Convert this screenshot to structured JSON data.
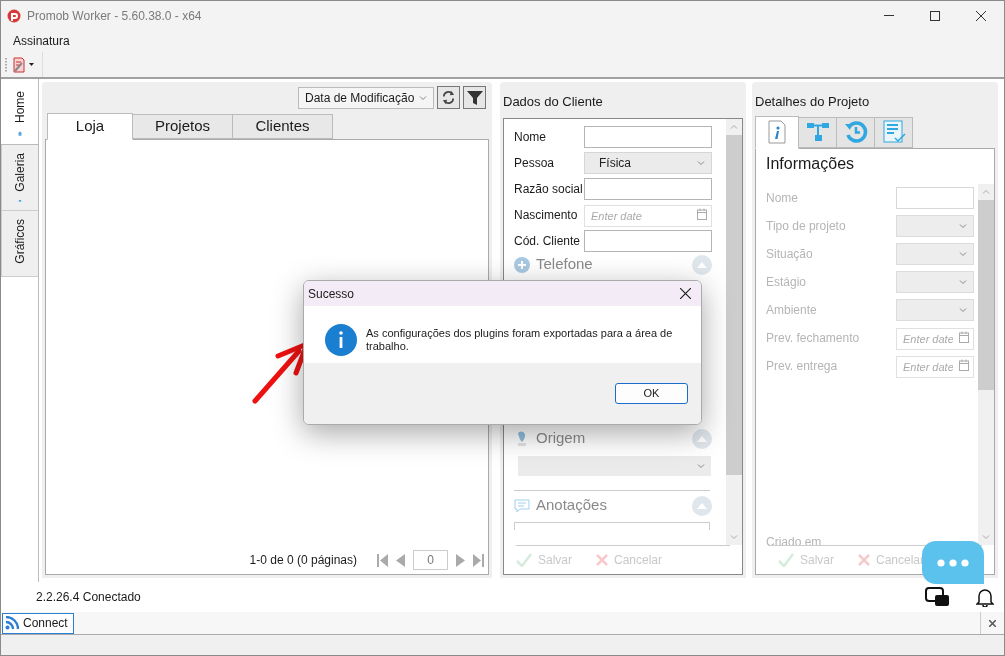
{
  "window": {
    "title": "Promob Worker - 5.60.38.0 - x64"
  },
  "menu": [
    "Assinatura"
  ],
  "side_tabs": [
    {
      "label": "Home",
      "selected": true
    },
    {
      "label": "Galeria",
      "selected": false
    },
    {
      "label": "Gráficos",
      "selected": false
    }
  ],
  "list_panel": {
    "sort": "Data de Modificação",
    "tabs": [
      {
        "label": "Loja",
        "selected": true
      },
      {
        "label": "Projetos",
        "selected": false
      },
      {
        "label": "Clientes",
        "selected": false
      }
    ],
    "pager": {
      "summary": "1-0 de 0 (0 páginas)",
      "page": "0"
    }
  },
  "client_panel": {
    "title": "Dados do Cliente",
    "fields": [
      {
        "kind": "text",
        "label": "Nome"
      },
      {
        "kind": "select",
        "label": "Pessoa",
        "value": "Física"
      },
      {
        "kind": "text",
        "label": "Razão social"
      },
      {
        "kind": "date",
        "label": "Nascimento",
        "placeholder": "Enter date"
      },
      {
        "kind": "text",
        "label": "Cód. Cliente"
      }
    ],
    "sections": [
      {
        "title": "Telefone",
        "kind": "plain"
      },
      {
        "title": "Origem",
        "kind": "select"
      },
      {
        "title": "Anotações",
        "kind": "text"
      }
    ],
    "buttons": [
      {
        "label": "Salvar",
        "kind": "save",
        "disabled": true
      },
      {
        "label": "Cancelar",
        "kind": "cancel",
        "disabled": true
      }
    ]
  },
  "project_panel": {
    "title": "Detalhes do Projeto",
    "tabs": [
      {
        "kind": "info",
        "selected": true
      },
      {
        "kind": "tree",
        "selected": false
      },
      {
        "kind": "history",
        "selected": false
      },
      {
        "kind": "checklist",
        "selected": false
      }
    ],
    "heading": "Informações",
    "fields": [
      {
        "kind": "text",
        "label": "Nome",
        "disabled": true
      },
      {
        "kind": "select",
        "label": "Tipo de projeto",
        "disabled": true
      },
      {
        "kind": "select",
        "label": "Situação",
        "disabled": true
      },
      {
        "kind": "select",
        "label": "Estágio",
        "disabled": true
      },
      {
        "kind": "select",
        "label": "Ambiente",
        "disabled": true
      },
      {
        "kind": "date",
        "label": "Prev. fechamento",
        "placeholder": "Enter date",
        "disabled": true
      },
      {
        "kind": "date",
        "label": "Prev. entrega",
        "placeholder": "Enter date",
        "disabled": true
      }
    ],
    "footer_label": "Criado em",
    "buttons": [
      {
        "label": "Salvar",
        "kind": "save",
        "disabled": true
      },
      {
        "label": "Cancelar",
        "kind": "cancel",
        "disabled": true
      }
    ]
  },
  "status": {
    "version": "2.2.26.4",
    "state": "Conectado"
  },
  "connect": {
    "label": "Connect"
  },
  "dialog": {
    "title": "Sucesso",
    "message": "As configurações dos plugins foram exportadas para a área de trabalho.",
    "buttons": [
      "OK"
    ]
  }
}
